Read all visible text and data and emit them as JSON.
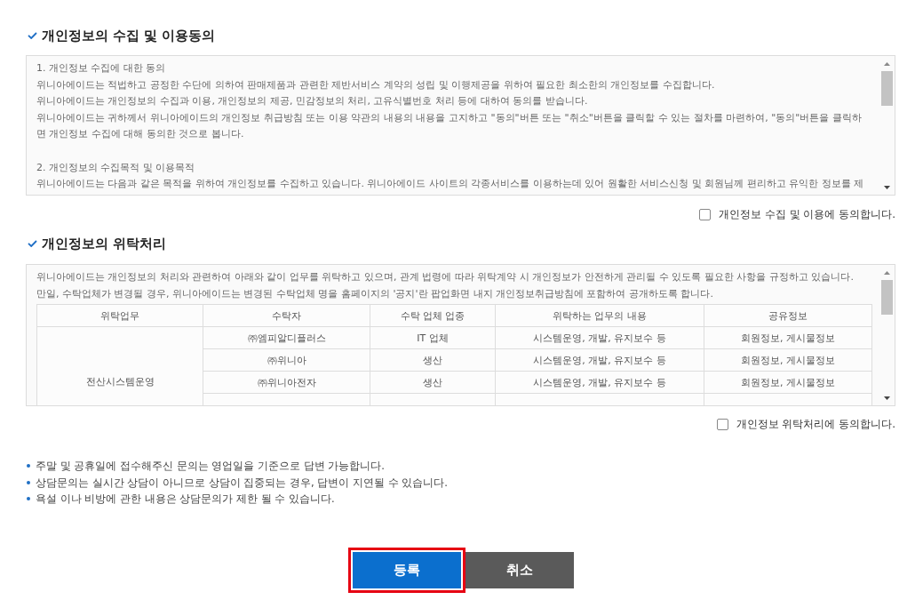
{
  "sections": [
    {
      "kind": "clauses",
      "title": "개인정보의 수집 및 이용동의",
      "clauses": [
        {
          "heading": "1. 개인정보 수집에 대한 동의",
          "lines": [
            "위니아에이드는 적법하고 공정한 수단에 의하여 판매제품과 관련한 제반서비스 계약의 성립 및 이행제공을 위하여 필요한 최소한의 개인정보를 수집합니다.",
            "위니아에이드는 개인정보의 수집과 이용, 개인정보의 제공, 민감정보의 처리, 고유식별번호 처리 등에 대하여 동의를 받습니다.",
            "위니아에이드는 귀하께서 위니아에이드의 개인정보 취급방침 또는 이용 약관의 내용의 내용을 고지하고 \"동의\"버튼 또는 \"취소\"버튼을 클릭할 수 있는 절차를 마련하여, \"동의\"버튼을 클릭하면 개인정보 수집에 대해 동의한 것으로 봅니다."
          ]
        },
        {
          "heading": "2. 개인정보의 수집목적 및 이용목적",
          "lines": [
            "위니아에이드는 다음과 같은 목적을 위하여 개인정보를 수집하고 있습니다. 위니아에이드 사이트의 각종서비스를 이용하는데 있어 원활한 서비스신청 및 회원님께 편리하고 유익한 정보를 제"
          ]
        }
      ],
      "agreement": {
        "label": "개인정보 수집 및 이용에 동의합니다.",
        "checked": false
      }
    },
    {
      "kind": "table",
      "title": "개인정보의 위탁처리",
      "intro": [
        "위니아에이드는 개인정보의 처리와 관련하여 아래와 같이 업무를 위탁하고 있으며, 관계 법령에 따라 위탁계약 시 개인정보가 안전하게 관리될 수 있도록 필요한 사항을 규정하고 있습니다.",
        "만일, 수탁업체가 변경될 경우, 위니아에이드는 변경된 수탁업체 명을 홈페이지의 '공지'란 팝업화면 내지 개인정보취급방침에 포함하여 공개하도록 합니다."
      ],
      "table": {
        "columns": [
          "위탁업무",
          "수탁자",
          "수탁 업체 업종",
          "위탁하는 업무의 내용",
          "공유정보"
        ],
        "groups": [
          {
            "task": "전산시스템운영",
            "rows": [
              {
                "company": "㈜엠피알디플러스",
                "industry": "IT 업체",
                "work": "시스템운영, 개발, 유지보수 등",
                "shared": "회원정보, 게시물정보"
              },
              {
                "company": "㈜위니아",
                "industry": "생산",
                "work": "시스템운영, 개발, 유지보수 등",
                "shared": "회원정보, 게시물정보"
              },
              {
                "company": "㈜위니아전자",
                "industry": "생산",
                "work": "시스템운영, 개발, 유지보수 등",
                "shared": "회원정보, 게시물정보"
              }
            ]
          }
        ]
      },
      "agreement": {
        "label": "개인정보 위탁처리에 동의합니다.",
        "checked": false
      }
    }
  ],
  "notes": [
    "주말 및 공휴일에 접수해주신 문의는 영업일을 기준으로 답변 가능합니다.",
    "상담문의는 실시간 상담이 아니므로 상담이 집중되는 경우, 답변이 지연될 수 있습니다.",
    "욕설 이나 비방에 관한 내용은 상담문의가 제한 될 수 있습니다."
  ],
  "buttons": [
    {
      "label": "등록",
      "kind": "primary",
      "highlighted": true
    },
    {
      "label": "취소",
      "kind": "secondary",
      "highlighted": false
    }
  ]
}
